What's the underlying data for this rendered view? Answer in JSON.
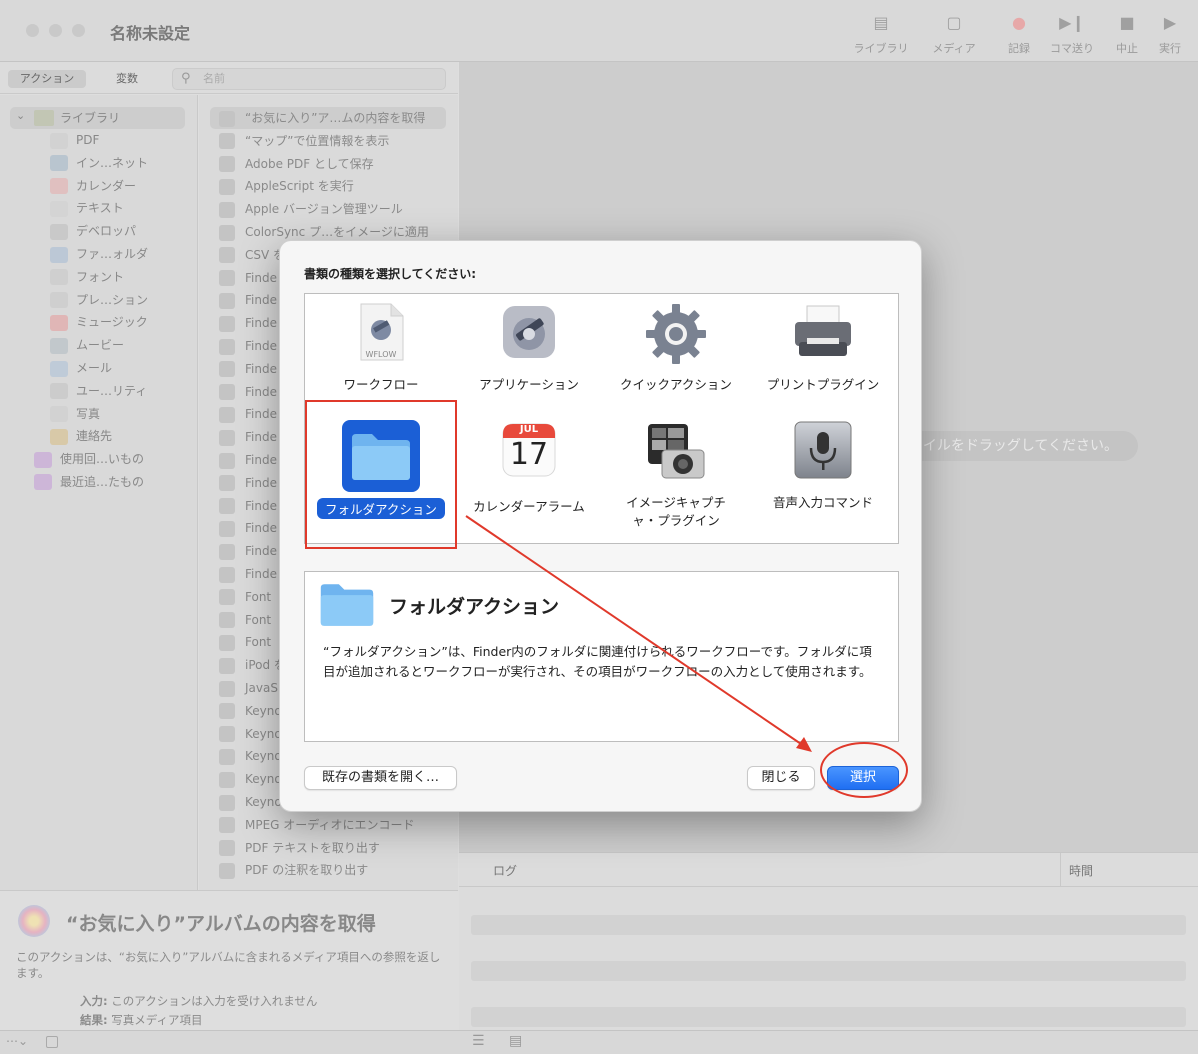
{
  "window": {
    "title": "名称未設定"
  },
  "toolbar": [
    {
      "label": "ライブラリ",
      "icon": "library-icon"
    },
    {
      "label": "メディア",
      "icon": "media-icon"
    },
    {
      "label": "記録",
      "icon": "record-icon"
    },
    {
      "label": "コマ送り",
      "icon": "step-icon"
    },
    {
      "label": "中止",
      "icon": "stop-icon"
    },
    {
      "label": "実行",
      "icon": "run-icon"
    }
  ],
  "tabs": {
    "actions": "アクション",
    "variables": "変数",
    "search_placeholder": "名前"
  },
  "library": {
    "root": "ライブラリ",
    "items": [
      "PDF",
      "イン…ネット",
      "カレンダー",
      "テキスト",
      "デベロッパ",
      "ファ…ォルダ",
      "フォント",
      "プレ…ション",
      "ミュージック",
      "ムービー",
      "メール",
      "ユー…リティ",
      "写真",
      "連絡先"
    ],
    "smart": [
      "使用回…いもの",
      "最近追…たもの"
    ]
  },
  "actions": [
    "“お気に入り”ア…ムの内容を取得",
    "“マップ”で位置情報を表示",
    "Adobe PDF として保存",
    "AppleScript を実行",
    "Apple バージョン管理ツール",
    "ColorSync プ…をイメージに適用",
    "CSV を",
    "Finde",
    "Finde",
    "Finde",
    "Finde",
    "Finde",
    "Finde",
    "Finde",
    "Finde",
    "Finde",
    "Finde",
    "Finde",
    "Finde",
    "Finde",
    "Finde",
    "Font",
    "Font",
    "Font",
    "iPod を",
    "JavaS",
    "Keyno",
    "Keyno",
    "Keyno",
    "Keyno",
    "Keyno",
    "MPEG オーディオにエンコード",
    "PDF テキストを取り出す",
    "PDF の注釈を取り出す"
  ],
  "action_description": {
    "title": "“お気に入り”アルバムの内容を取得",
    "body": "このアクションは、“お気に入り”アルバムに含まれるメディア項目への参照を返します。",
    "input_label": "入力:",
    "input_value": "このアクションは入力を受け入れません",
    "result_label": "結果:",
    "result_value": "写真メディア項目"
  },
  "canvas": {
    "drop_hint": "イルをドラッグしてください。"
  },
  "log": {
    "col_log": "ログ",
    "col_time": "時間"
  },
  "dialog": {
    "title": "書類の種類を選択してください:",
    "types": [
      {
        "label": "ワークフロー",
        "icon": "workflow-document-icon",
        "badge": "WFLOW"
      },
      {
        "label": "アプリケーション",
        "icon": "automator-robot-icon"
      },
      {
        "label": "クイックアクション",
        "icon": "gear-icon"
      },
      {
        "label": "プリントプラグイン",
        "icon": "printer-icon"
      },
      {
        "label": "フォルダアクション",
        "icon": "folder-icon",
        "selected": true
      },
      {
        "label": "カレンダーアラーム",
        "icon": "calendar-icon",
        "month": "JUL",
        "day": "17"
      },
      {
        "label": "イメージキャプチャ・プラグイン",
        "icon": "camera-icon"
      },
      {
        "label": "音声入力コマンド",
        "icon": "microphone-icon"
      }
    ],
    "detail": {
      "title": "フォルダアクション",
      "body": "“フォルダアクション”は、Finder内のフォルダに関連付けられるワークフローです。フォルダに項目が追加されるとワークフローが実行され、その項目がワークフローの入力として使用されます。"
    },
    "buttons": {
      "open_existing": "既存の書類を開く…",
      "close": "閉じる",
      "choose": "選択"
    }
  },
  "colors": {
    "accent": "#1f6ff2",
    "annotation": "#e0392b",
    "selection": "#1b5fd6"
  }
}
